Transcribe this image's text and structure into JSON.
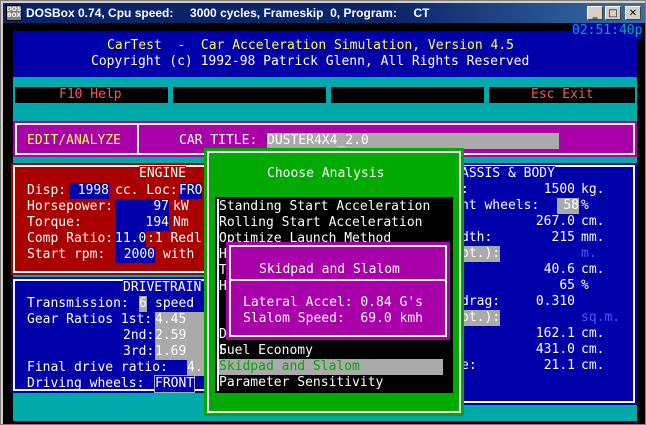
{
  "window": {
    "title": "DOSBox 0.74, Cpu speed:     3000 cycles, Frameskip  0, Program:     CT",
    "icon_text_top": "DOS",
    "icon_text_bottom": "BOX",
    "minimize_glyph": "_",
    "maximize_glyph": "□",
    "close_glyph": "✕"
  },
  "app": {
    "clock": "02:51:40p",
    "title": "CarTest  -  Car Acceleration Simulation, Version 4.5",
    "copyright": "Copyright (c) 1992-98 Patrick Glenn, All Rights Reserved",
    "menu": {
      "help": "F10 Help",
      "exit": "Esc Exit"
    },
    "mode": "EDIT/ANALYZE",
    "car_title_label": "CAR TITLE:",
    "car_title": "DUSTER4X4_2.0"
  },
  "engine": {
    "header": "ENGINE",
    "disp_label": "Disp:",
    "disp": "1998",
    "disp_unit": "cc. Loc:",
    "loc": "FRO",
    "hp_label": "Horsepower:",
    "hp": "97",
    "hp_unit": "kW",
    "torque_label": "Torque:",
    "torque": "194",
    "torque_unit": "Nm",
    "comp_label": "Comp Ratio:",
    "comp": "11.0",
    "comp_unit": ":1 Redl",
    "start_label": "Start rpm:",
    "start": "2000",
    "start_unit": "with"
  },
  "drivetrain": {
    "header": "DRIVETRAIN",
    "trans_label": "Transmission:",
    "trans": "6",
    "trans_unit": "speed",
    "gear_label": "Gear Ratios 1st:",
    "g1": "4.45",
    "g2_label": "2nd:",
    "g2": "2.59",
    "g3_label": "3rd:",
    "g3": "1.69",
    "final_label": "Final drive ratio:",
    "final": "4.",
    "wheels_label": "Driving wheels:",
    "wheels": "FRONT"
  },
  "chassis": {
    "header": "ASSIS & BODY",
    "r1_val": "1500",
    "r1_unit": "kg.",
    "r2_label": "nt wheels:",
    "r2_val": "58",
    "r2_unit": "%",
    "r3_val": "267.0",
    "r3_unit": "cm.",
    "r4_label": "dth:",
    "r4_val": "215",
    "r4_unit": "mm.",
    "r5_label": "pt.):",
    "r5_unit": "m.",
    "r6_val": "40.6",
    "r6_unit": "cm.",
    "r7_val": "65",
    "r7_unit": "%",
    "r8_label": "drag:",
    "r8_val": "0.310",
    "r9_label": "pt.):",
    "r9_unit": "sq.m.",
    "r10_val": "162.1",
    "r10_unit": "cm.",
    "r11_val": "431.0",
    "r11_unit": "cm.",
    "r12_label": "e:",
    "r12_val": "21.1",
    "r12_unit": "cm."
  },
  "analysis_menu": {
    "title": "Choose Analysis",
    "items": [
      "Standing Start Acceleration",
      "Rolling Start Acceleration",
      "Optimize Launch Method",
      "H",
      "T",
      "H",
      "D",
      "S",
      "S",
      "Fuel Economy",
      "Skidpad and Slalom",
      "Parameter Sensitivity"
    ],
    "selected": "Skidpad and Slalom"
  },
  "skidpad": {
    "title": "Skidpad and Slalom",
    "lateral": "Lateral Accel: 0.84 G's",
    "slalom": "Slalom Speed:  69.0 kmh"
  },
  "colors": {
    "dos_blue": "#0000aa",
    "dos_cyan": "#00aaaa",
    "dos_magenta": "#aa00aa",
    "dos_red": "#aa0000",
    "dos_green": "#00aa00",
    "dos_gray": "#aaaaaa",
    "dos_yellow": "#ffff55",
    "dos_white": "#ffffff",
    "dos_black": "#000000"
  }
}
